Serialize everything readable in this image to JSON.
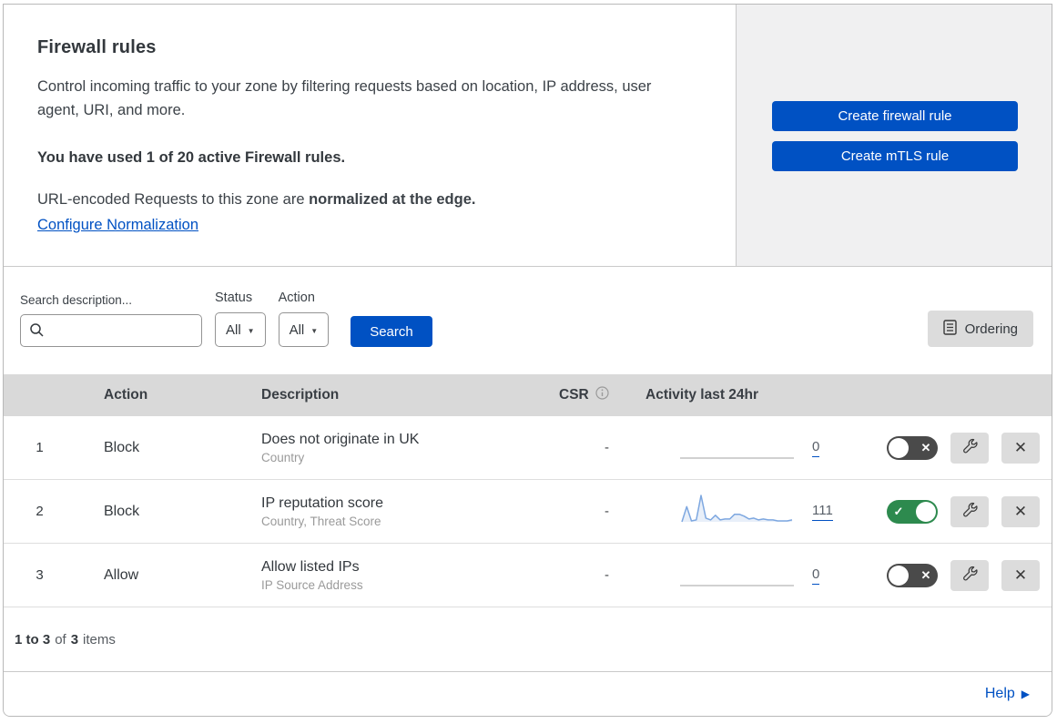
{
  "intro": {
    "title": "Firewall rules",
    "description": "Control incoming traffic to your zone by filtering requests based on location, IP address, user agent, URI, and more.",
    "usage": "You have used 1 of 20 active Firewall rules.",
    "normalization_prefix": "URL-encoded Requests to this zone are ",
    "normalization_bold": "normalized at the edge.",
    "configure_link": "Configure Normalization"
  },
  "actions_panel": {
    "create_firewall_rule": "Create firewall rule",
    "create_mtls_rule": "Create mTLS rule"
  },
  "filters": {
    "search_label": "Search description...",
    "search_value": "",
    "status_label": "Status",
    "status_value": "All",
    "action_label": "Action",
    "action_value": "All",
    "search_button": "Search",
    "ordering_button": "Ordering"
  },
  "table": {
    "headers": {
      "action": "Action",
      "description": "Description",
      "csr": "CSR",
      "activity": "Activity last 24hr"
    },
    "rows": [
      {
        "index": "1",
        "action": "Block",
        "description": "Does not originate in UK",
        "fields": "Country",
        "csr": "-",
        "count": "0",
        "enabled": false,
        "spark": null
      },
      {
        "index": "2",
        "action": "Block",
        "description": "IP reputation score",
        "fields": "Country, Threat Score",
        "csr": "-",
        "count": "111",
        "enabled": true,
        "spark": [
          0,
          16,
          1,
          2,
          28,
          4,
          2,
          7,
          2,
          3,
          3,
          8,
          8,
          6,
          3,
          4,
          2,
          3,
          2,
          2,
          1,
          1,
          1,
          2
        ]
      },
      {
        "index": "3",
        "action": "Allow",
        "description": "Allow listed IPs",
        "fields": "IP Source Address",
        "csr": "-",
        "count": "0",
        "enabled": false,
        "spark": null
      }
    ]
  },
  "footer": {
    "range": "1 to 3",
    "of": "of",
    "total": "3",
    "items": "items"
  },
  "help": {
    "label": "Help"
  },
  "icons": {
    "search": "magnifier",
    "csr_info": "info-circle",
    "ordering": "list-page",
    "edit": "wrench",
    "delete": "x",
    "toggle_on": "check",
    "toggle_off": "x",
    "help_arrow": "triangle-right"
  },
  "colors": {
    "primary_blue": "#0051c3",
    "toggle_on_green": "#2d8a4e",
    "toggle_off_gray": "#4a4a4a",
    "spark_line": "#7da7e0",
    "spark_fill": "rgba(125,167,224,0.18)",
    "header_strip": "#d9d9d9",
    "panel_gray": "#f0f0f1"
  }
}
